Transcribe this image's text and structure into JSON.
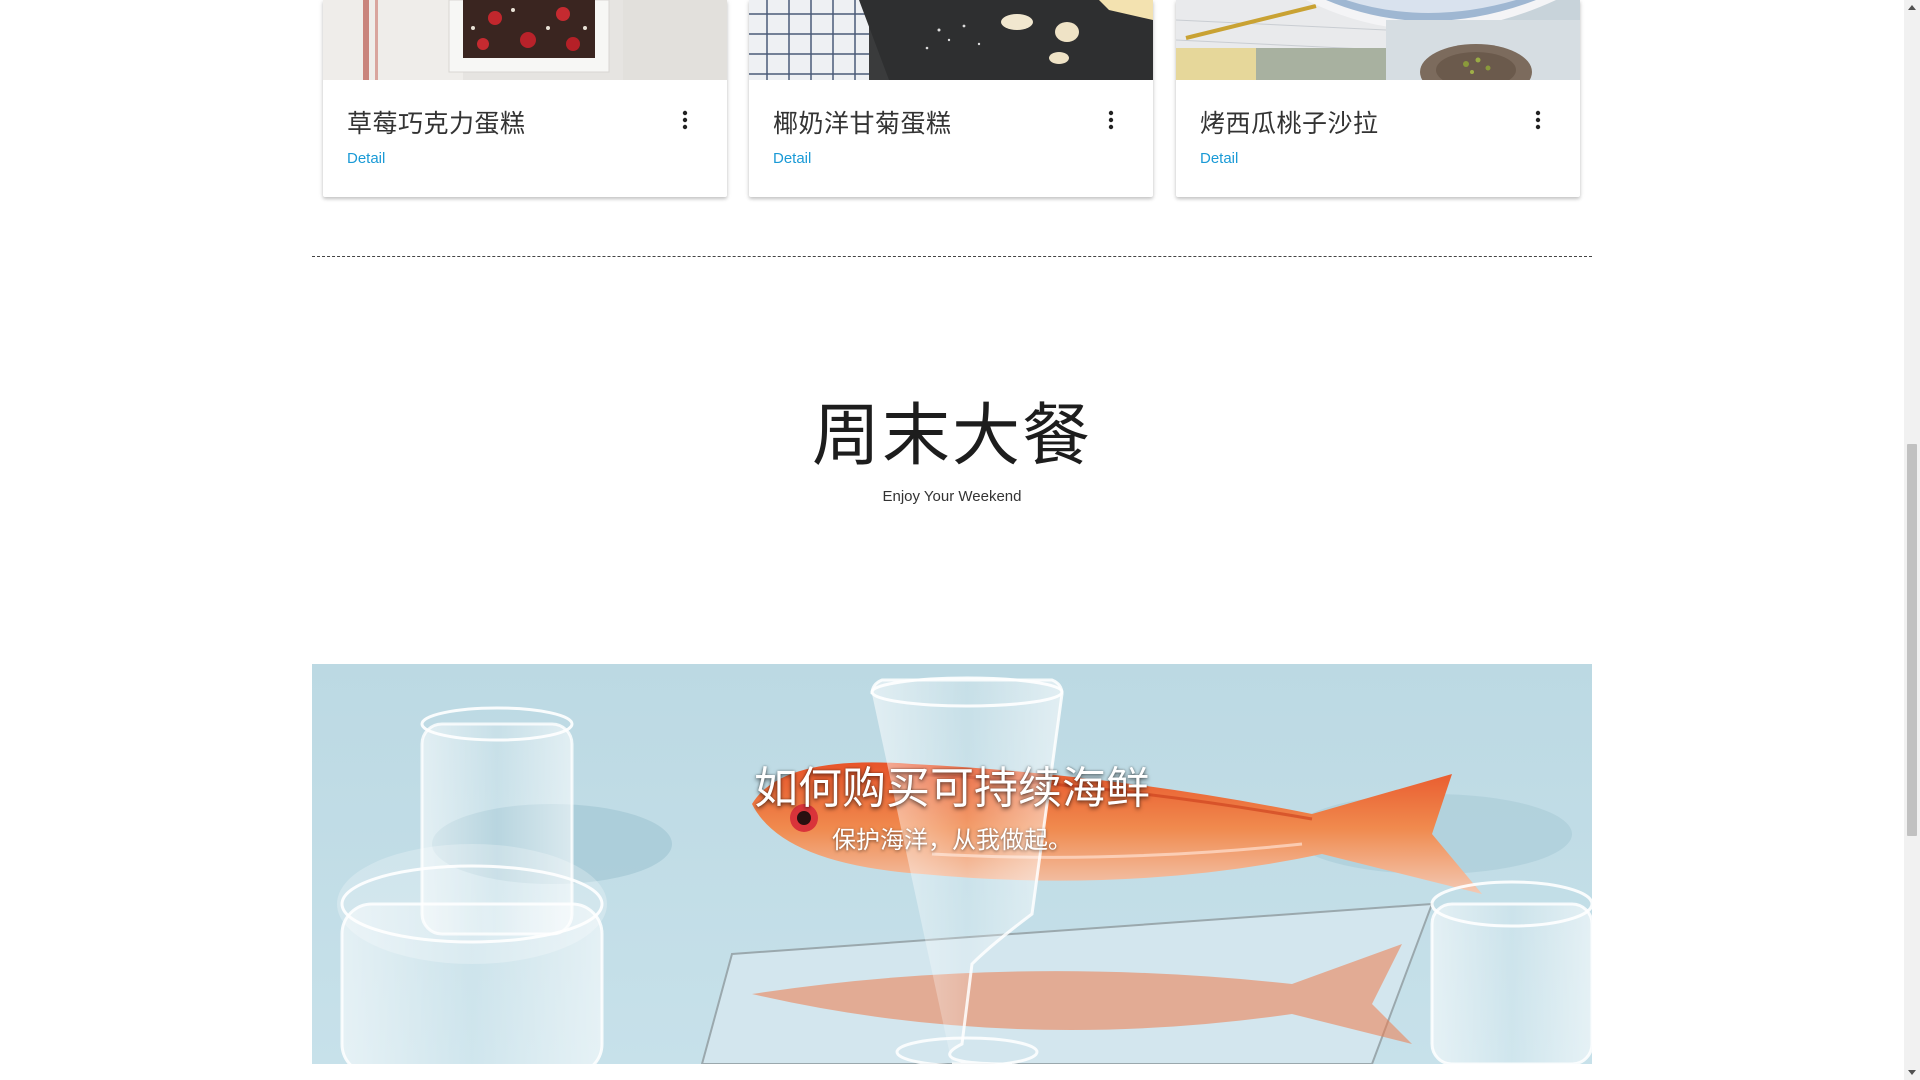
{
  "cards": [
    {
      "title": "草莓巧克力蛋糕",
      "link": "Detail",
      "image_icon": "strawberry-chocolate-cake-photo",
      "menu_icon": "more-vert-icon"
    },
    {
      "title": "椰奶洋甘菊蛋糕",
      "link": "Detail",
      "image_icon": "coconut-chamomile-cake-photo",
      "menu_icon": "more-vert-icon"
    },
    {
      "title": "烤西瓜桃子沙拉",
      "link": "Detail",
      "image_icon": "watermelon-peach-salad-photo",
      "menu_icon": "more-vert-icon"
    }
  ],
  "section": {
    "title": "周末大餐",
    "subtitle": "Enjoy Your Weekend"
  },
  "banner": {
    "title": "如何购买可持续海鲜",
    "subtitle": "保护海洋，从我做起。",
    "image_icon": "red-mullet-fish-on-mirror-photo"
  },
  "colors": {
    "link": "#1a9ad6",
    "banner_bg": "#b9d9e4",
    "text": "#333333"
  }
}
